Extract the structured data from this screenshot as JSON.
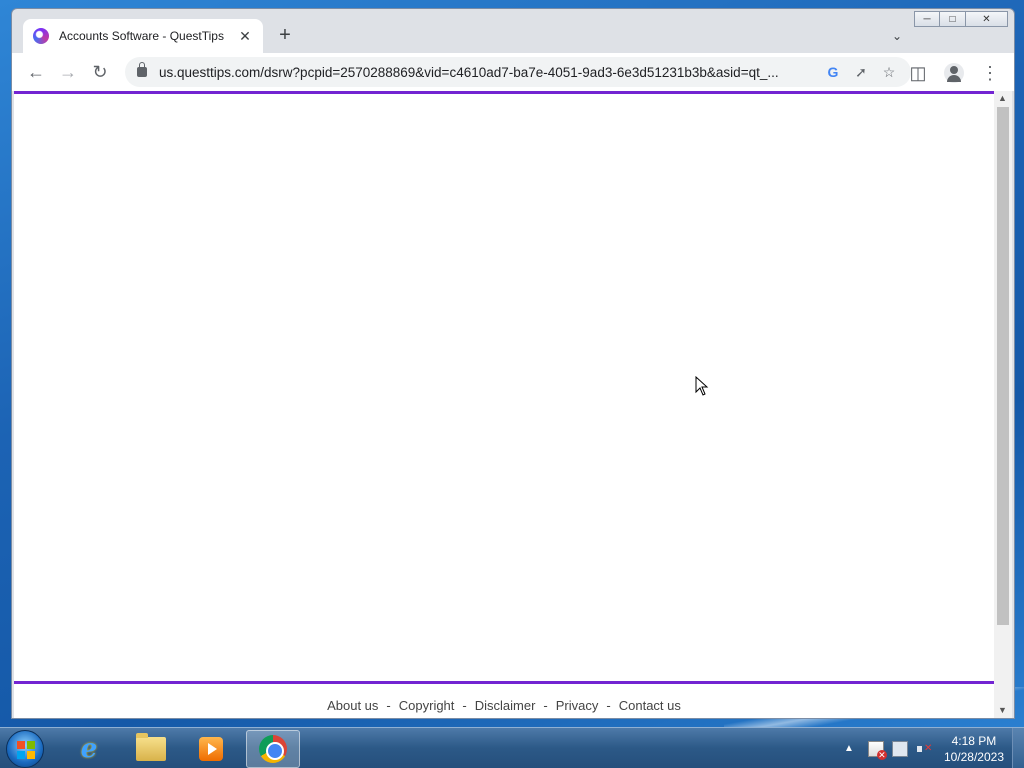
{
  "browser": {
    "tab_title": "Accounts Software - QuestTips",
    "new_tab_symbol": "+",
    "url": "us.questtips.com/dsrw?pcpid=2570288869&vid=c4610ad7-ba7e-4051-9ad3-6e3d51231b3b&asid=qt_..."
  },
  "page": {
    "accent_color": "#7324d2",
    "footer_links": [
      {
        "label": "About us"
      },
      {
        "label": "Copyright"
      },
      {
        "label": "Disclaimer"
      },
      {
        "label": "Privacy"
      },
      {
        "label": "Contact us"
      }
    ],
    "separator": "-"
  },
  "taskbar": {
    "pinned": [
      "internet-explorer",
      "windows-explorer",
      "media-player",
      "google-chrome"
    ],
    "clock_time": "4:18 PM",
    "clock_date": "10/28/2023"
  }
}
